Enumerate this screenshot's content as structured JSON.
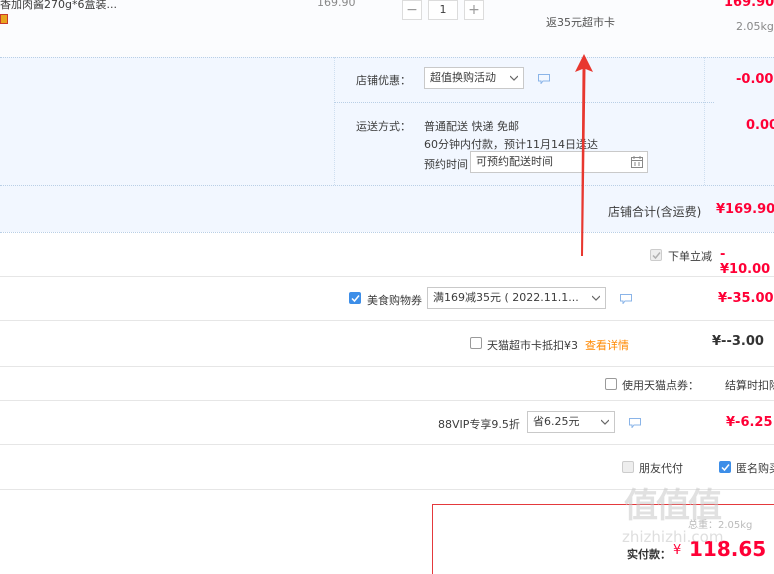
{
  "product": {
    "name": "香加肉酱270g*6盒装...",
    "unit_price": "169.90",
    "quantity": "1",
    "rebate_note": "返35元超市卡",
    "subtotal": "169.90",
    "weight": "2.05kg"
  },
  "shop_discount": {
    "label": "店铺优惠：",
    "selected": "超值换购活动",
    "amount": "-0.00"
  },
  "shipping": {
    "label": "运送方式：",
    "method": "普通配送 快递 免邮",
    "eta": "60分钟内付款，预计11月14日送达",
    "reserve_label": "预约时间",
    "reserve_placeholder": "可预约配送时间",
    "amount": "0.00"
  },
  "shop_total": {
    "label": "店铺合计(含运费)",
    "amount": "¥169.90"
  },
  "instant_discount": {
    "label": "下单立减",
    "amount": "-¥10.00",
    "checked": true
  },
  "food_coupon": {
    "label": "美食购物券",
    "selected": "满169减35元 ( 2022.11.1...",
    "amount": "¥-35.00",
    "checked": true
  },
  "supermarket_card": {
    "label": "天猫超市卡抵扣¥3",
    "link": "查看详情",
    "amount": "¥--3.00",
    "checked": false
  },
  "tmall_points": {
    "label": "使用天猫点券：",
    "note": "结算时扣除",
    "checked": false
  },
  "vip": {
    "label": "88VIP专享9.5折",
    "selected": "省6.25元",
    "amount": "¥-6.25"
  },
  "options": {
    "friend_pay": "朋友代付",
    "anonymous": "匿名购买"
  },
  "payment": {
    "label": "实付款：",
    "currency": "¥",
    "amount": "118.65",
    "shipping_weight": "总重：2.05kg"
  },
  "watermark": {
    "logo": "值值值",
    "site": "zhizhizhi.com"
  },
  "colors": {
    "accent": "#ff0036",
    "checkbox": "#3d8ee8",
    "link": "#ff8800",
    "band": "#f2f7ff",
    "arrow": "#e8372f"
  }
}
